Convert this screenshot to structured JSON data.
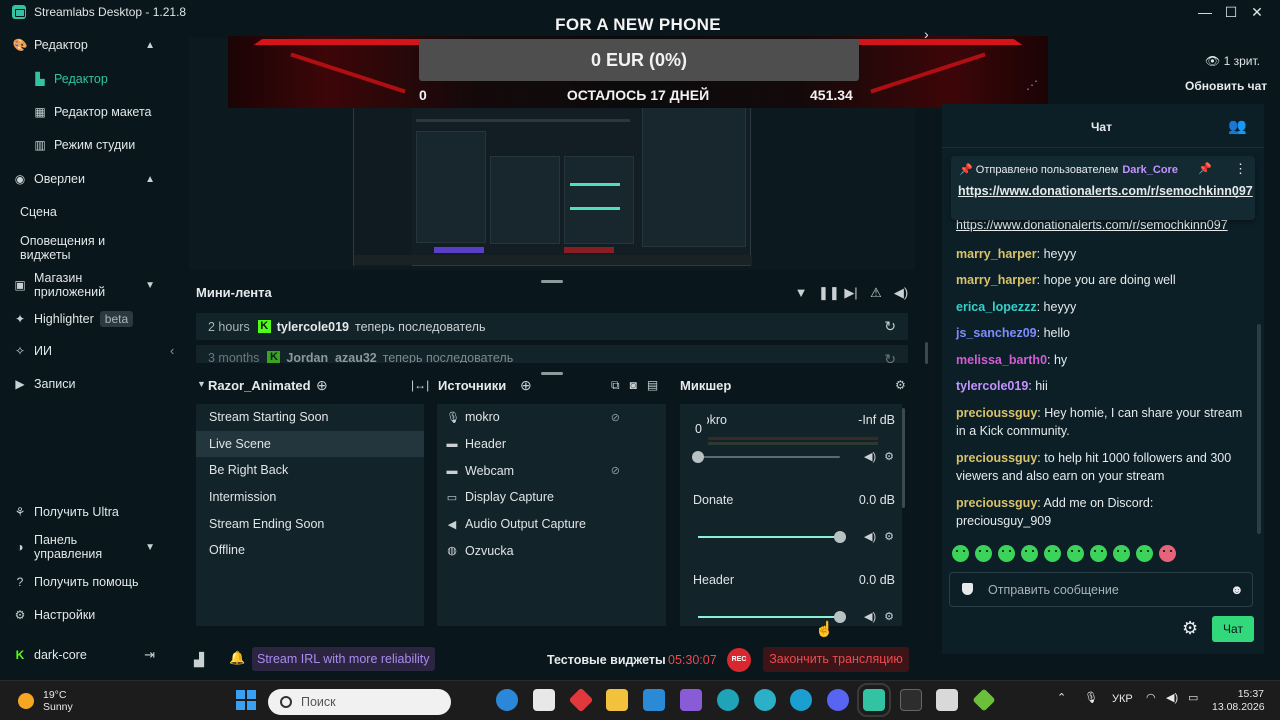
{
  "window": {
    "title": "Streamlabs Desktop - 1.21.8",
    "minimize": "—",
    "maximize": "☐",
    "close": "✕"
  },
  "sidebar": {
    "editor_group": "Редактор",
    "items": [
      {
        "label": "Редактор",
        "icon": "editor-icon"
      },
      {
        "label": "Редактор макета",
        "icon": "layout-editor-icon"
      },
      {
        "label": "Режим студии",
        "icon": "studio-mode-icon"
      }
    ],
    "overlays": "Оверлеи",
    "scene": "Сцена",
    "alerts": "Оповещения и виджеты",
    "app_store": "Магазин приложений",
    "highlighter": "Highlighter",
    "beta": "beta",
    "ai": "ИИ",
    "recordings": "Записи",
    "ultra": "Получить Ultra",
    "dashboard": "Панель управления",
    "help": "Получить помощь",
    "settings": "Настройки",
    "account": "dark-core"
  },
  "banner": {
    "title": "FOR A NEW PHONE",
    "amount": "0 EUR (0%)",
    "start": "0",
    "remaining": "ОСТАЛОСЬ 17 ДНЕЙ",
    "goal": "451.34"
  },
  "mini_feed": {
    "title": "Мини-лента",
    "rows": [
      {
        "time": "2 hours",
        "user": "tylercole019",
        "action": "теперь последователь"
      },
      {
        "time": "3 months",
        "user": "Jordan_azau32",
        "action": "теперь последователь"
      }
    ]
  },
  "scenes": {
    "title": "Razor_Animated",
    "items": [
      "Stream Starting Soon",
      "Live Scene",
      "Be Right Back",
      "Intermission",
      "Stream Ending Soon",
      "Offline"
    ],
    "active_index": 1
  },
  "sources": {
    "title": "Источники",
    "items": [
      {
        "label": "mokro",
        "icon": "microphone-icon",
        "hidden": true
      },
      {
        "label": "Header",
        "icon": "folder-icon",
        "hidden": false
      },
      {
        "label": "Webcam",
        "icon": "folder-icon",
        "hidden": true
      },
      {
        "label": "Display Capture",
        "icon": "monitor-icon",
        "hidden": false
      },
      {
        "label": "Audio Output Capture",
        "icon": "speaker-icon",
        "hidden": false
      },
      {
        "label": "Ozvucka",
        "icon": "globe-icon",
        "hidden": false
      }
    ]
  },
  "mixer": {
    "title": "Микшер",
    "items": [
      {
        "name": "mokro",
        "db": "-Inf dB",
        "level": 0,
        "overlay": "0"
      },
      {
        "name": "Donate",
        "db": "0.0 dB",
        "level": 1
      },
      {
        "name": "Header",
        "db": "0.0 dB",
        "level": 1
      }
    ]
  },
  "footer": {
    "irl": "Stream IRL with more reliability",
    "test_widgets": "Тестовые виджеты",
    "timer": "05:30:07",
    "rec": "REC",
    "end_stream": "Закончить трансляцию"
  },
  "right": {
    "viewers": "1 зрит.",
    "refresh": "Обновить чат"
  },
  "chat": {
    "title": "Чат",
    "pinned_by": "Отправлено пользователем",
    "pinned_user": "Dark_Core",
    "pinned_link": "https://www.donationalerts.com/r/semochkinn097",
    "behind_link": "https://www.donationalerts.com/r/semochkinn097",
    "messages": [
      {
        "user": "marry_harper",
        "text": "heyyy",
        "color": "#d9c26a"
      },
      {
        "user": "marry_harper",
        "text": "hope you are doing well",
        "color": "#d9c26a"
      },
      {
        "user": "erica_lopezzz",
        "text": "heyyy",
        "color": "#35d0c8"
      },
      {
        "user": "js_sanchez09",
        "text": "hello",
        "color": "#7d8cff"
      },
      {
        "user": "melissa_barth0",
        "text": "hy",
        "color": "#d25bd6"
      },
      {
        "user": "tylercole019",
        "text": "hii",
        "color": "#c392ff"
      },
      {
        "user": "precioussguy",
        "text": "Hey homie, I can share your stream in a Kick community.",
        "color": "#d9c26a"
      },
      {
        "user": "precioussguy",
        "text": "to help hit 1000 followers and 300 viewers and also earn on your stream",
        "color": "#d9c26a"
      },
      {
        "user": "precioussguy",
        "text": "Add me on Discord: preciousguy_909",
        "color": "#d9c26a"
      }
    ],
    "input_placeholder": "Отправить сообщение",
    "send": "Чат"
  },
  "taskbar": {
    "temp": "19°C",
    "condition": "Sunny",
    "search_placeholder": "Поиск",
    "lang": "УКР",
    "time": "15:37",
    "date": "13.08.2026"
  }
}
